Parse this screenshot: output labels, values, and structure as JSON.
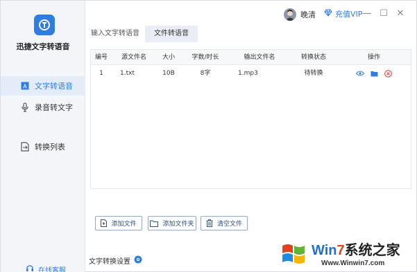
{
  "app": {
    "name": "迅捷文字转语音"
  },
  "sidebar": {
    "items": [
      {
        "label": "文字转语音",
        "icon": "text-to-speech-icon",
        "active": true
      },
      {
        "label": "录音转文字",
        "icon": "microphone-icon",
        "active": false
      },
      {
        "label": "转换列表",
        "icon": "conversion-list-icon",
        "active": false
      }
    ],
    "support_label": "在线客服"
  },
  "header": {
    "username": "晚清",
    "vip_label": "充值VIP",
    "minimize": "—",
    "maximize": "☐",
    "close": "✕"
  },
  "tabs": [
    {
      "label": "输入文字转语音",
      "active": false
    },
    {
      "label": "文件转语音",
      "active": true
    }
  ],
  "table": {
    "columns": [
      "编号",
      "源文件名",
      "大小",
      "字数/时长",
      "输出文件名",
      "转换状态",
      "操作"
    ],
    "rows": [
      {
        "id": "1",
        "source": "1.txt",
        "size": "10B",
        "count": "8字",
        "output": "1.mp3",
        "status": "待转换"
      }
    ]
  },
  "buttons": {
    "add_file": "添加文件",
    "add_folder": "添加文件夹",
    "clear": "清空文件"
  },
  "settings": {
    "label": "文字转换设置"
  },
  "watermark": {
    "title_part1": "Win",
    "title_part2": "7",
    "title_part3": "系统之家",
    "url": "Www.Winwin7.com"
  },
  "colors": {
    "accent": "#2f7de1",
    "sidebar_bg": "#f3f5f8",
    "delete": "#e5484d"
  }
}
